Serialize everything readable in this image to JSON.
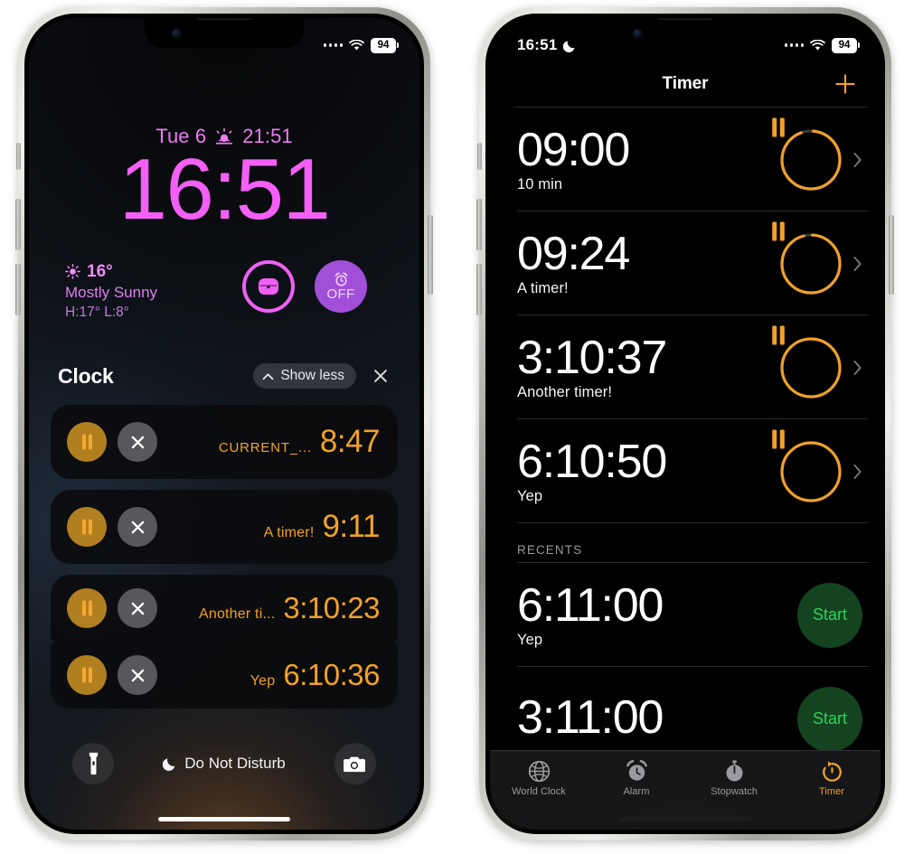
{
  "lock_screen": {
    "status_bar": {
      "signal_dots": 4,
      "wifi_icon": "wifi-icon",
      "battery_level": "94"
    },
    "date": "Tue 6",
    "sunset_icon": "sunset-icon",
    "sunset_time": "21:51",
    "time": "16:51",
    "weather": {
      "icon": "sun-icon",
      "temperature": "16°",
      "condition": "Mostly Sunny",
      "high_low": "H:17° L:8°"
    },
    "widgets": [
      {
        "name": "airpods-widget",
        "icon": "airpods-case-icon"
      },
      {
        "name": "alarm-widget",
        "icon": "alarm-clock-icon",
        "label": "OFF"
      }
    ],
    "notification_group": {
      "title": "Clock",
      "show_less_label": "Show less",
      "chevron_icon": "chevron-up-icon",
      "close_icon": "close-x-icon"
    },
    "notifications": [
      {
        "label": "CURRENT_...",
        "time": "8:47",
        "pause_icon": "pause-icon",
        "close_icon": "close-x-icon"
      },
      {
        "label": "A timer!",
        "time": "9:11",
        "pause_icon": "pause-icon",
        "close_icon": "close-x-icon"
      },
      {
        "label": "Another ti...",
        "time": "3:10:23",
        "pause_icon": "pause-icon",
        "close_icon": "close-x-icon"
      },
      {
        "label": "Yep",
        "time": "6:10:36",
        "pause_icon": "pause-icon",
        "close_icon": "close-x-icon"
      }
    ],
    "bottom_bar": {
      "flashlight_icon": "flashlight-icon",
      "camera_icon": "camera-icon",
      "focus_icon": "moon-icon",
      "focus_label": "Do Not Disturb"
    }
  },
  "timer_app": {
    "status_bar": {
      "time": "16:51",
      "focus_icon": "moon-icon",
      "signal_dots": 4,
      "wifi_icon": "wifi-icon",
      "battery_level": "94"
    },
    "nav": {
      "title": "Timer",
      "add_icon": "plus-icon"
    },
    "active_timers": [
      {
        "time": "09:00",
        "name": "10 min",
        "progress": 0.93,
        "pause_icon": "pause-icon",
        "chevron_icon": "chevron-right-icon"
      },
      {
        "time": "09:24",
        "name": "A timer!",
        "progress": 0.95,
        "pause_icon": "pause-icon",
        "chevron_icon": "chevron-right-icon"
      },
      {
        "time": "3:10:37",
        "name": "Another timer!",
        "progress": 1.0,
        "pause_icon": "pause-icon",
        "chevron_icon": "chevron-right-icon"
      },
      {
        "time": "6:10:50",
        "name": "Yep",
        "progress": 1.0,
        "pause_icon": "pause-icon",
        "chevron_icon": "chevron-right-icon"
      }
    ],
    "recents_header": "RECENTS",
    "recents": [
      {
        "time": "6:11:00",
        "name": "Yep",
        "start_label": "Start"
      },
      {
        "time": "3:11:00",
        "name": "",
        "start_label": "Start"
      }
    ],
    "tabs": [
      {
        "label": "World Clock",
        "icon": "globe-icon",
        "active": false
      },
      {
        "label": "Alarm",
        "icon": "alarm-icon",
        "active": false
      },
      {
        "label": "Stopwatch",
        "icon": "stopwatch-icon",
        "active": false
      },
      {
        "label": "Timer",
        "icon": "timer-icon",
        "active": true
      }
    ]
  },
  "colors": {
    "lock_accent": "#f45ff5",
    "timer_orange": "#f0a02a",
    "start_green": "#31d158",
    "notif_amber": "#f2a227"
  }
}
